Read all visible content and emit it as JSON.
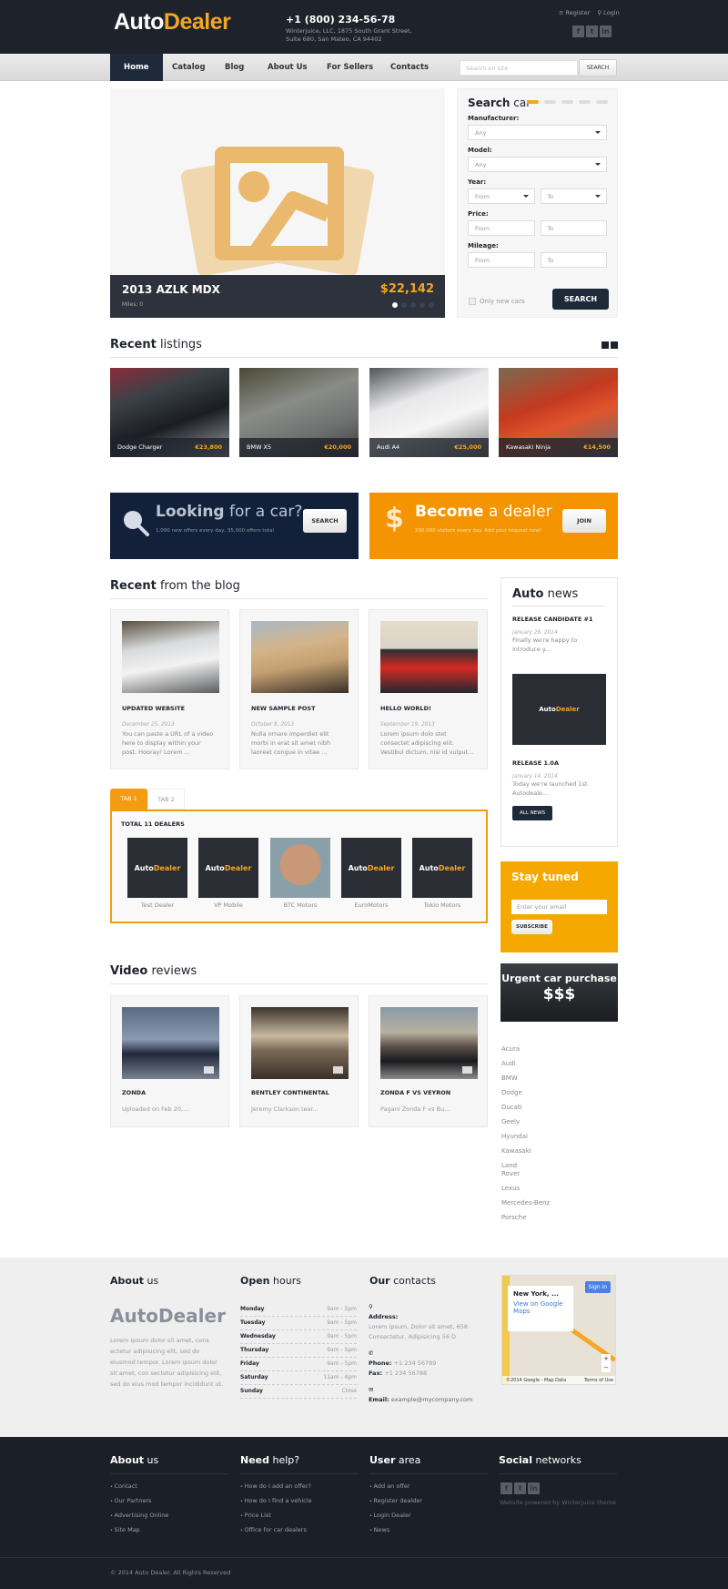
{
  "header": {
    "logo_part1": "Auto",
    "logo_part2": "Dealer",
    "phone": "+1 (800) 234-56-78",
    "address_line1": "Winterjuice, LLC, 1875 South Grant Street,",
    "address_line2": "Suite 680, San Mateo, CA 94402",
    "register": "≡ Register",
    "login": "⚲ Login",
    "social": [
      "f",
      "t",
      "in"
    ]
  },
  "nav": {
    "items": [
      "Home",
      "Catalog",
      "Blog",
      "About Us",
      "For Sellers",
      "Contacts"
    ],
    "search_placeholder": "Search on site",
    "search_button": "SEARCH"
  },
  "hero": {
    "title": "2013 AZLK MDX",
    "miles": "Miles: 0",
    "price": "$22,142",
    "slides": 5,
    "active_slide": 1
  },
  "search_car": {
    "title_bold": "Search",
    "title_rest": " car",
    "manufacturer_label": "Manufacturer:",
    "manufacturer_value": "Any",
    "model_label": "Model:",
    "model_value": "Any",
    "year_label": "Year:",
    "year_from": "From",
    "year_to": "To",
    "price_label": "Price:",
    "price_from": "From",
    "price_to": "To",
    "mileage_label": "Mileage:",
    "mileage_from": "From",
    "mileage_to": "To",
    "only_new": "Only new cars",
    "button": "SEARCH"
  },
  "recent_listings": {
    "title_bold": "Recent",
    "title_rest": " listings",
    "items": [
      {
        "name": "Dodge Charger",
        "price": "€23,800"
      },
      {
        "name": "BMW X5",
        "price": "€20,000"
      },
      {
        "name": "Audi A4",
        "price": "€25,000"
      },
      {
        "name": "Kawasaki Ninja",
        "price": "€14,500"
      }
    ]
  },
  "banners": {
    "looking": {
      "bold": "Looking",
      "rest": " for a car?",
      "sub": "1,000 new offers every day, 35,000 offers total",
      "button": "SEARCH"
    },
    "dealer": {
      "bold": "Become",
      "rest": " a dealer",
      "sub": "200,000 visitors every day. Add your request now!",
      "button": "JOIN"
    }
  },
  "blog": {
    "title_bold": "Recent",
    "title_rest": " from the blog",
    "posts": [
      {
        "title": "UPDATED WEBSITE",
        "date": "December 25, 2013",
        "excerpt": "You can paste a URL of a video here to display within your post. Hooray! Lorem ..."
      },
      {
        "title": "NEW SAMPLE POST",
        "date": "October 8, 2013",
        "excerpt": "Nulla ornare imperdiet elit morbi in erat sit amet nibh laoreet congue in vitae ..."
      },
      {
        "title": "HELLO WORLD!",
        "date": "September 19, 2013",
        "excerpt": "Lorem ipsum dolo stet consectet adipiscing elit. Vestibul dictum, nisi id vulput..."
      }
    ]
  },
  "auto_news": {
    "title_bold": "Auto",
    "title_rest": " news",
    "items": [
      {
        "title": "RELEASE CANDIDATE #1",
        "date": "January 28, 2014",
        "excerpt": "Finally we're happy to introduce y..."
      },
      {
        "title": "RELEASE 1.0A",
        "date": "January 14, 2014",
        "excerpt": "Today we're launched 1st Autodeale..."
      }
    ],
    "button": "ALL NEWS"
  },
  "dealers": {
    "tabs": [
      "TAB 1",
      "TAB 2"
    ],
    "total": "TOTAL 11 DEALERS",
    "items": [
      "Test Dealer",
      "VP Mobile",
      "BTC Motors",
      "EuroMotors",
      "Tokio Motors"
    ]
  },
  "stay_tuned": {
    "title": "Stay tuned",
    "placeholder": "Enter your email",
    "button": "SUBSCRIBE"
  },
  "urgent": {
    "line1": "Urgent car purchase",
    "line2": "$$$"
  },
  "brands": [
    "Acura",
    "Audi",
    "BMW",
    "Dodge",
    "Ducati",
    "Geely",
    "Hyundai",
    "Kawasaki",
    "Land Rover",
    "Lexus",
    "Mercedes-Benz",
    "Porsche"
  ],
  "videos": {
    "title_bold": "Video",
    "title_rest": " reviews",
    "items": [
      {
        "title": "ZONDA",
        "excerpt": "Uploaded on Feb 20,..."
      },
      {
        "title": "BENTLEY CONTINENTAL",
        "excerpt": "Jeremy Clarkson tear..."
      },
      {
        "title": "ZONDA F VS VEYRON",
        "excerpt": "Pagani Zonda F vs Bu..."
      }
    ]
  },
  "footer_top": {
    "about": {
      "bold": "About",
      "rest": " us",
      "brand": "AutoDealer",
      "text": "Lorem ipsum dolor sit amet, cons ectetur adipisicing elit, sed do eiusmod tempor. Lorem ipsum dolor sit amet, con sectetur adipisicing elit, sed do eius mod tempor incididunt ut."
    },
    "hours": {
      "bold": "Open",
      "rest": " hours",
      "rows": [
        {
          "day": "Monday",
          "time": "9am - 5pm"
        },
        {
          "day": "Tuesday",
          "time": "9am - 5pm"
        },
        {
          "day": "Wednesday",
          "time": "9am - 5pm"
        },
        {
          "day": "Thursday",
          "time": "9am - 5pm"
        },
        {
          "day": "Friday",
          "time": "9am - 5pm"
        },
        {
          "day": "Saturday",
          "time": "11am - 4pm"
        },
        {
          "day": "Sunday",
          "time": "Close"
        }
      ]
    },
    "contacts": {
      "bold": "Our",
      "rest": " contacts",
      "address_label": "Address:",
      "address": "Lorem ipsum, Dolor sit amet, 658 Consectetur, Adipisicing 56 D",
      "phone_label": "Phone:",
      "phone": "+1 234 56789",
      "fax_label": "Fax:",
      "fax": "+1 234 56788",
      "email_label": "Email:",
      "email": "example@mycompany.com"
    },
    "map": {
      "place": "New York, ...",
      "link": "View on Google Maps",
      "sign_in": "Sign in",
      "copyright": "©2014 Google - Map Data",
      "terms": "Terms of Use"
    }
  },
  "footer_bottom": {
    "about": {
      "bold": "About",
      "rest": " us",
      "links": [
        "Contact",
        "Our Partners",
        "Advertising Online",
        "Site Map"
      ]
    },
    "help": {
      "bold": "Need",
      "rest": " help?",
      "links": [
        "How do I add an offer?",
        "How do I find a vehicle",
        "Price List",
        "Office for car dealers"
      ]
    },
    "user": {
      "bold": "User",
      "rest": " area",
      "links": [
        "Add an offer",
        "Register dealder",
        "Login Dealer",
        "News"
      ]
    },
    "social": {
      "bold": "Social",
      "rest": " networks",
      "powered": "Website powered by Winterjuice theme"
    },
    "copyright": "© 2014 Auto Dealer. All Rights Reserved"
  }
}
